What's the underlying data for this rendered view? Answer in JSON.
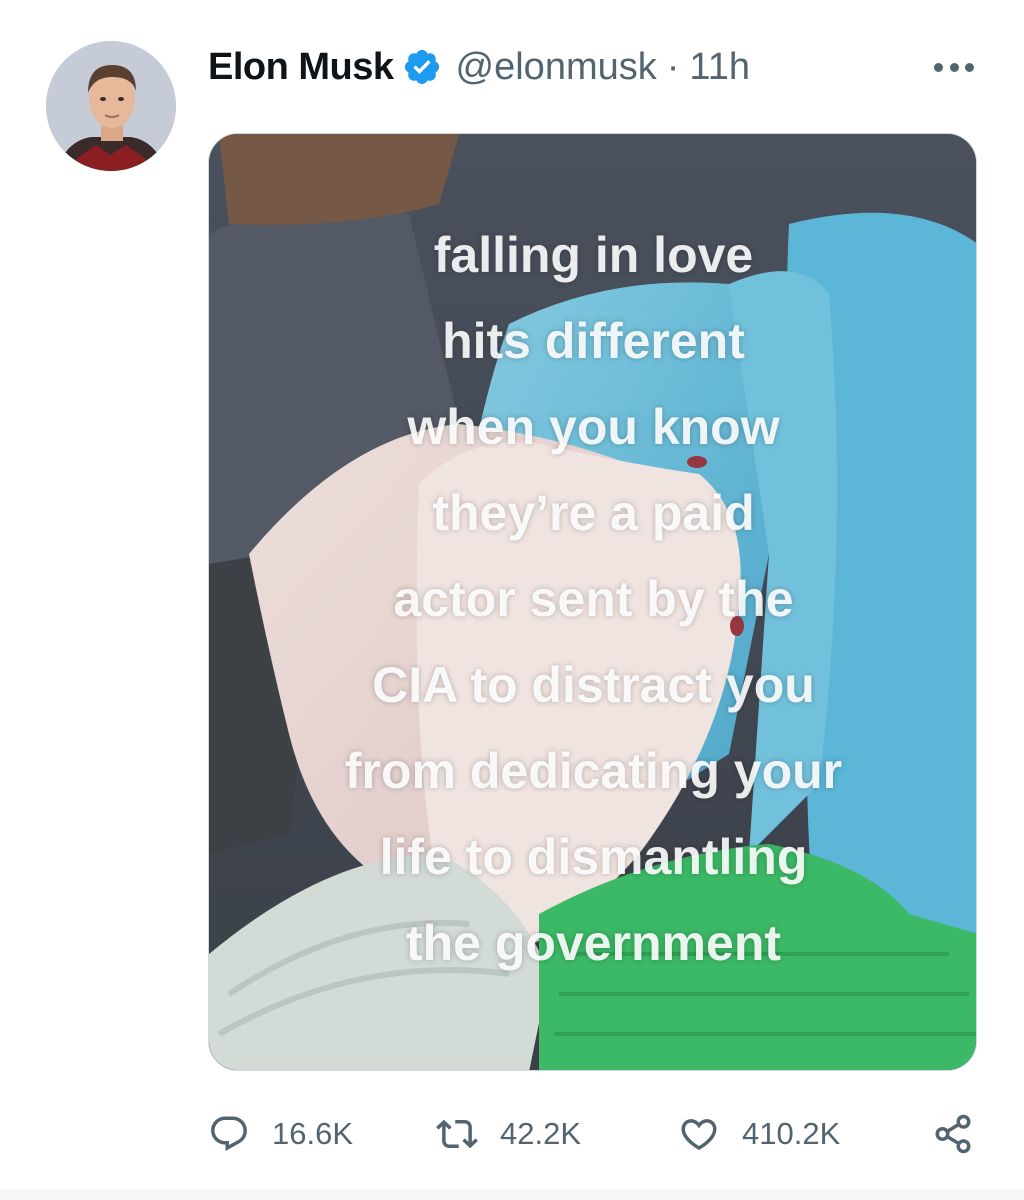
{
  "author": {
    "display_name": "Elon Musk",
    "handle": "@elonmusk",
    "separator": "·",
    "time": "11h",
    "verified_badge_color": "#1d9bf0",
    "avatar_icon": "profile-photo"
  },
  "more_icon": "ellipsis-icon",
  "media": {
    "caption_lines": [
      "falling in love",
      "hits different",
      "when you know",
      "they’re a paid",
      "actor sent by the",
      "CIA to distract you",
      "from dedicating your",
      "life to dismantling",
      "the government"
    ]
  },
  "actions": {
    "reply_count": "16.6K",
    "retweet_count": "42.2K",
    "like_count": "410.2K",
    "icons": [
      "reply-icon",
      "retweet-icon",
      "like-icon",
      "share-icon"
    ]
  },
  "colors": {
    "text_primary": "#0f1419",
    "text_secondary": "#536471",
    "accent": "#1d9bf0"
  }
}
